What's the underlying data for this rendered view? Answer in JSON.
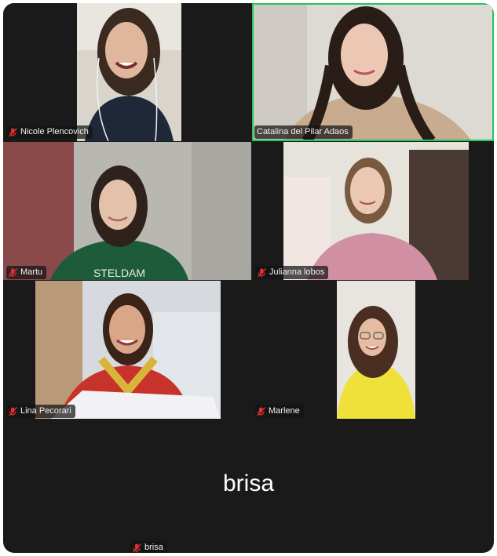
{
  "participants": [
    {
      "name": "Nicole Plencovich",
      "muted": true,
      "active_speaker": false,
      "video_on": true
    },
    {
      "name": "Catalina del Pilar Adaos",
      "muted": false,
      "active_speaker": true,
      "video_on": true
    },
    {
      "name": "Martu",
      "muted": true,
      "active_speaker": false,
      "video_on": true
    },
    {
      "name": "Julianna lobos",
      "muted": true,
      "active_speaker": false,
      "video_on": true
    },
    {
      "name": "Lina Pecorari",
      "muted": true,
      "active_speaker": false,
      "video_on": true
    },
    {
      "name": "Marlene",
      "muted": true,
      "active_speaker": false,
      "video_on": true
    },
    {
      "name": "brisa",
      "muted": true,
      "active_speaker": false,
      "video_on": false,
      "placeholder_name": "brisa"
    }
  ],
  "icons": {
    "mute": "microphone-muted-icon"
  },
  "colors": {
    "background": "#1a1a1a",
    "active_speaker_border": "#22c55e",
    "mute_icon": "#e02f2f"
  }
}
